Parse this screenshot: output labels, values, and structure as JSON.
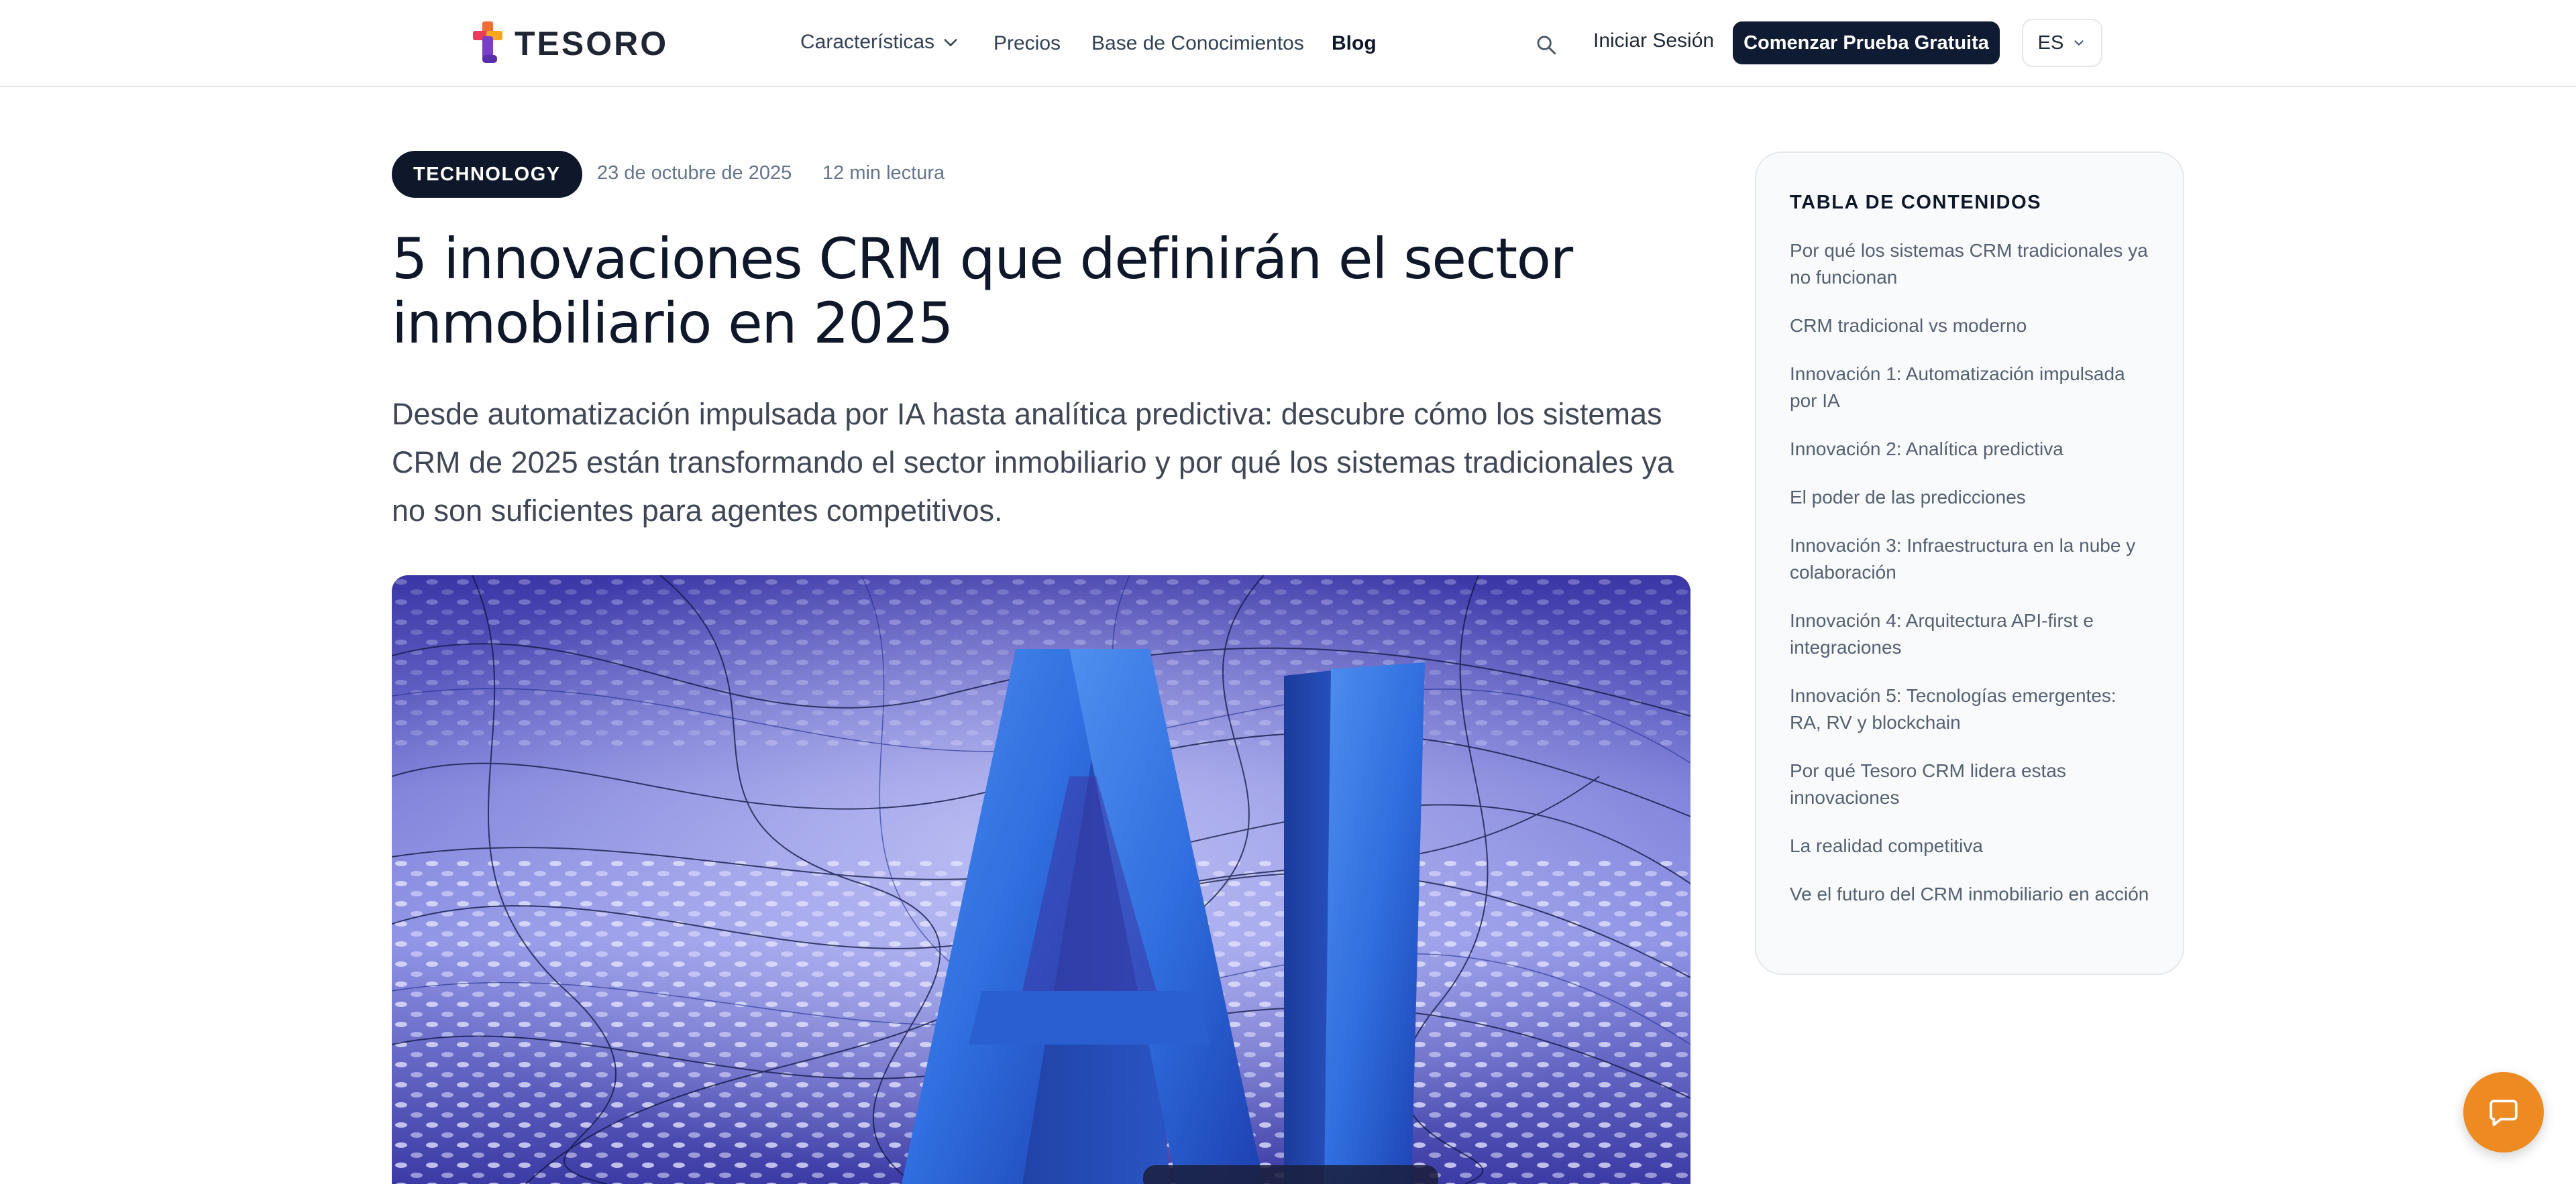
{
  "header": {
    "logo_text": "TESORO",
    "nav": [
      {
        "label": "Características",
        "has_dropdown": true
      },
      {
        "label": "Precios"
      },
      {
        "label": "Base de Conocimientos"
      },
      {
        "label": "Blog",
        "active": true
      }
    ],
    "login_label": "Iniciar Sesión",
    "cta_label": "Comenzar Prueba Gratuita",
    "language": "ES"
  },
  "article": {
    "category": "TECHNOLOGY",
    "date": "23 de octubre de 2025",
    "read_time": "12 min lectura",
    "title": "5 innovaciones CRM que definirán el sector inmobiliario en 2025",
    "lead": "Desde automatización impulsada por IA hasta analítica predictiva: descubre cómo los sistemas CRM de 2025 están transformando el sector inmobiliario y por qué los sistemas tradicionales ya no son suficientes para agentes competitivos.",
    "hero_image_text": "AI"
  },
  "toc": {
    "title": "TABLA DE CONTENIDOS",
    "items": [
      "Por qué los sistemas CRM tradicionales ya no funcionan",
      "CRM tradicional vs moderno",
      "Innovación 1: Automatización impulsada por IA",
      "Innovación 2: Analítica predictiva",
      "El poder de las predicciones",
      "Innovación 3: Infraestructura en la nube y colaboración",
      "Innovación 4: Arquitectura API-first e integraciones",
      "Innovación 5: Tecnologías emergentes: RA, RV y blockchain",
      "Por qué Tesoro CRM lidera estas innovaciones",
      "La realidad competitiva",
      "Ve el futuro del CRM inmobiliario en acción"
    ]
  },
  "colors": {
    "primary_dark": "#0f172a",
    "cta_navy": "#0f1a33",
    "chat_orange": "#ed8a22",
    "muted_text": "#64748b",
    "toc_background": "#f8fafc"
  },
  "icons": {
    "search": "search-icon",
    "chevron": "chevron-down-icon",
    "chat": "chat-bubble-icon",
    "logo": "tesoro-logo-icon"
  }
}
